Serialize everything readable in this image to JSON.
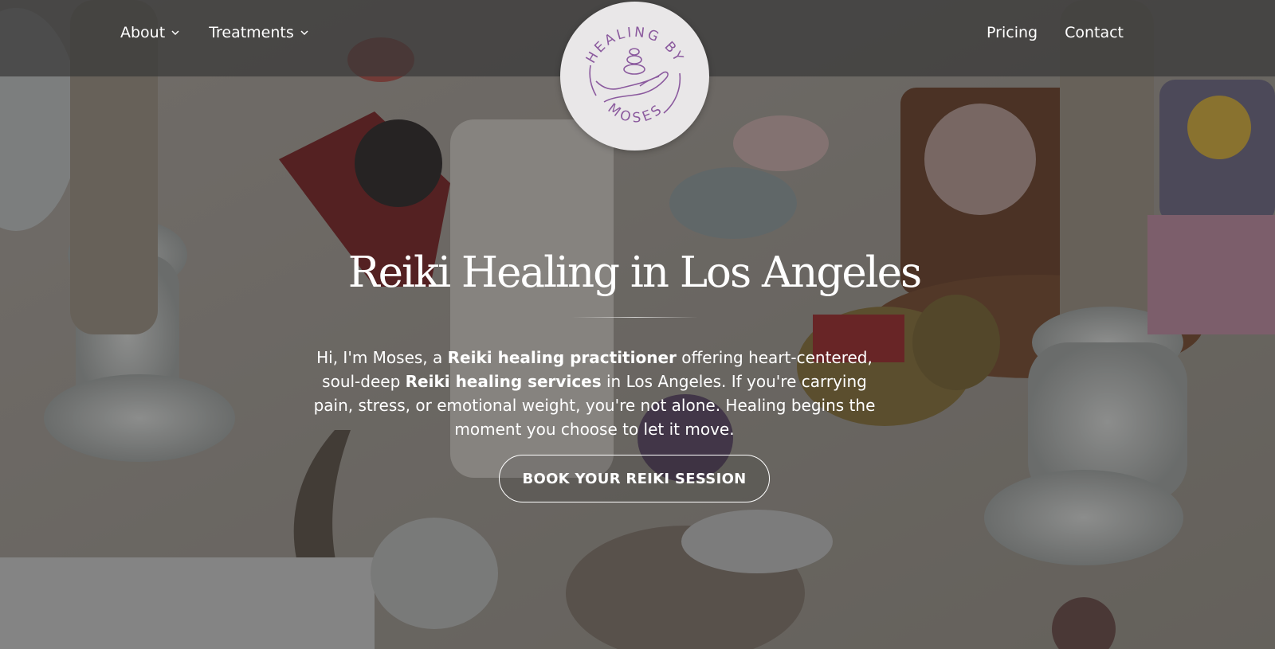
{
  "nav": {
    "left": [
      {
        "label": "About",
        "has_dropdown": true
      },
      {
        "label": "Treatments",
        "has_dropdown": true
      }
    ],
    "right": [
      {
        "label": "Pricing"
      },
      {
        "label": "Contact"
      }
    ]
  },
  "logo": {
    "text_top": "HEALING BY",
    "text_bottom": "MOSES",
    "color": "#8b5a9e"
  },
  "hero": {
    "title": "Reiki Healing in Los Angeles",
    "intro": {
      "t1": "Hi, I'm Moses, a ",
      "b1": "Reiki healing practitioner",
      "t2": " offering heart-centered, soul-deep ",
      "b2": "Reiki healing services",
      "t3": " in Los Angeles. If you're carrying pain, stress, or emotional weight, you're not alone. Healing begins the moment you choose to let it move."
    },
    "cta_label": "BOOK YOUR REIKI SESSION"
  },
  "colors": {
    "accent": "#8b5a9e",
    "text": "#ffffff"
  }
}
